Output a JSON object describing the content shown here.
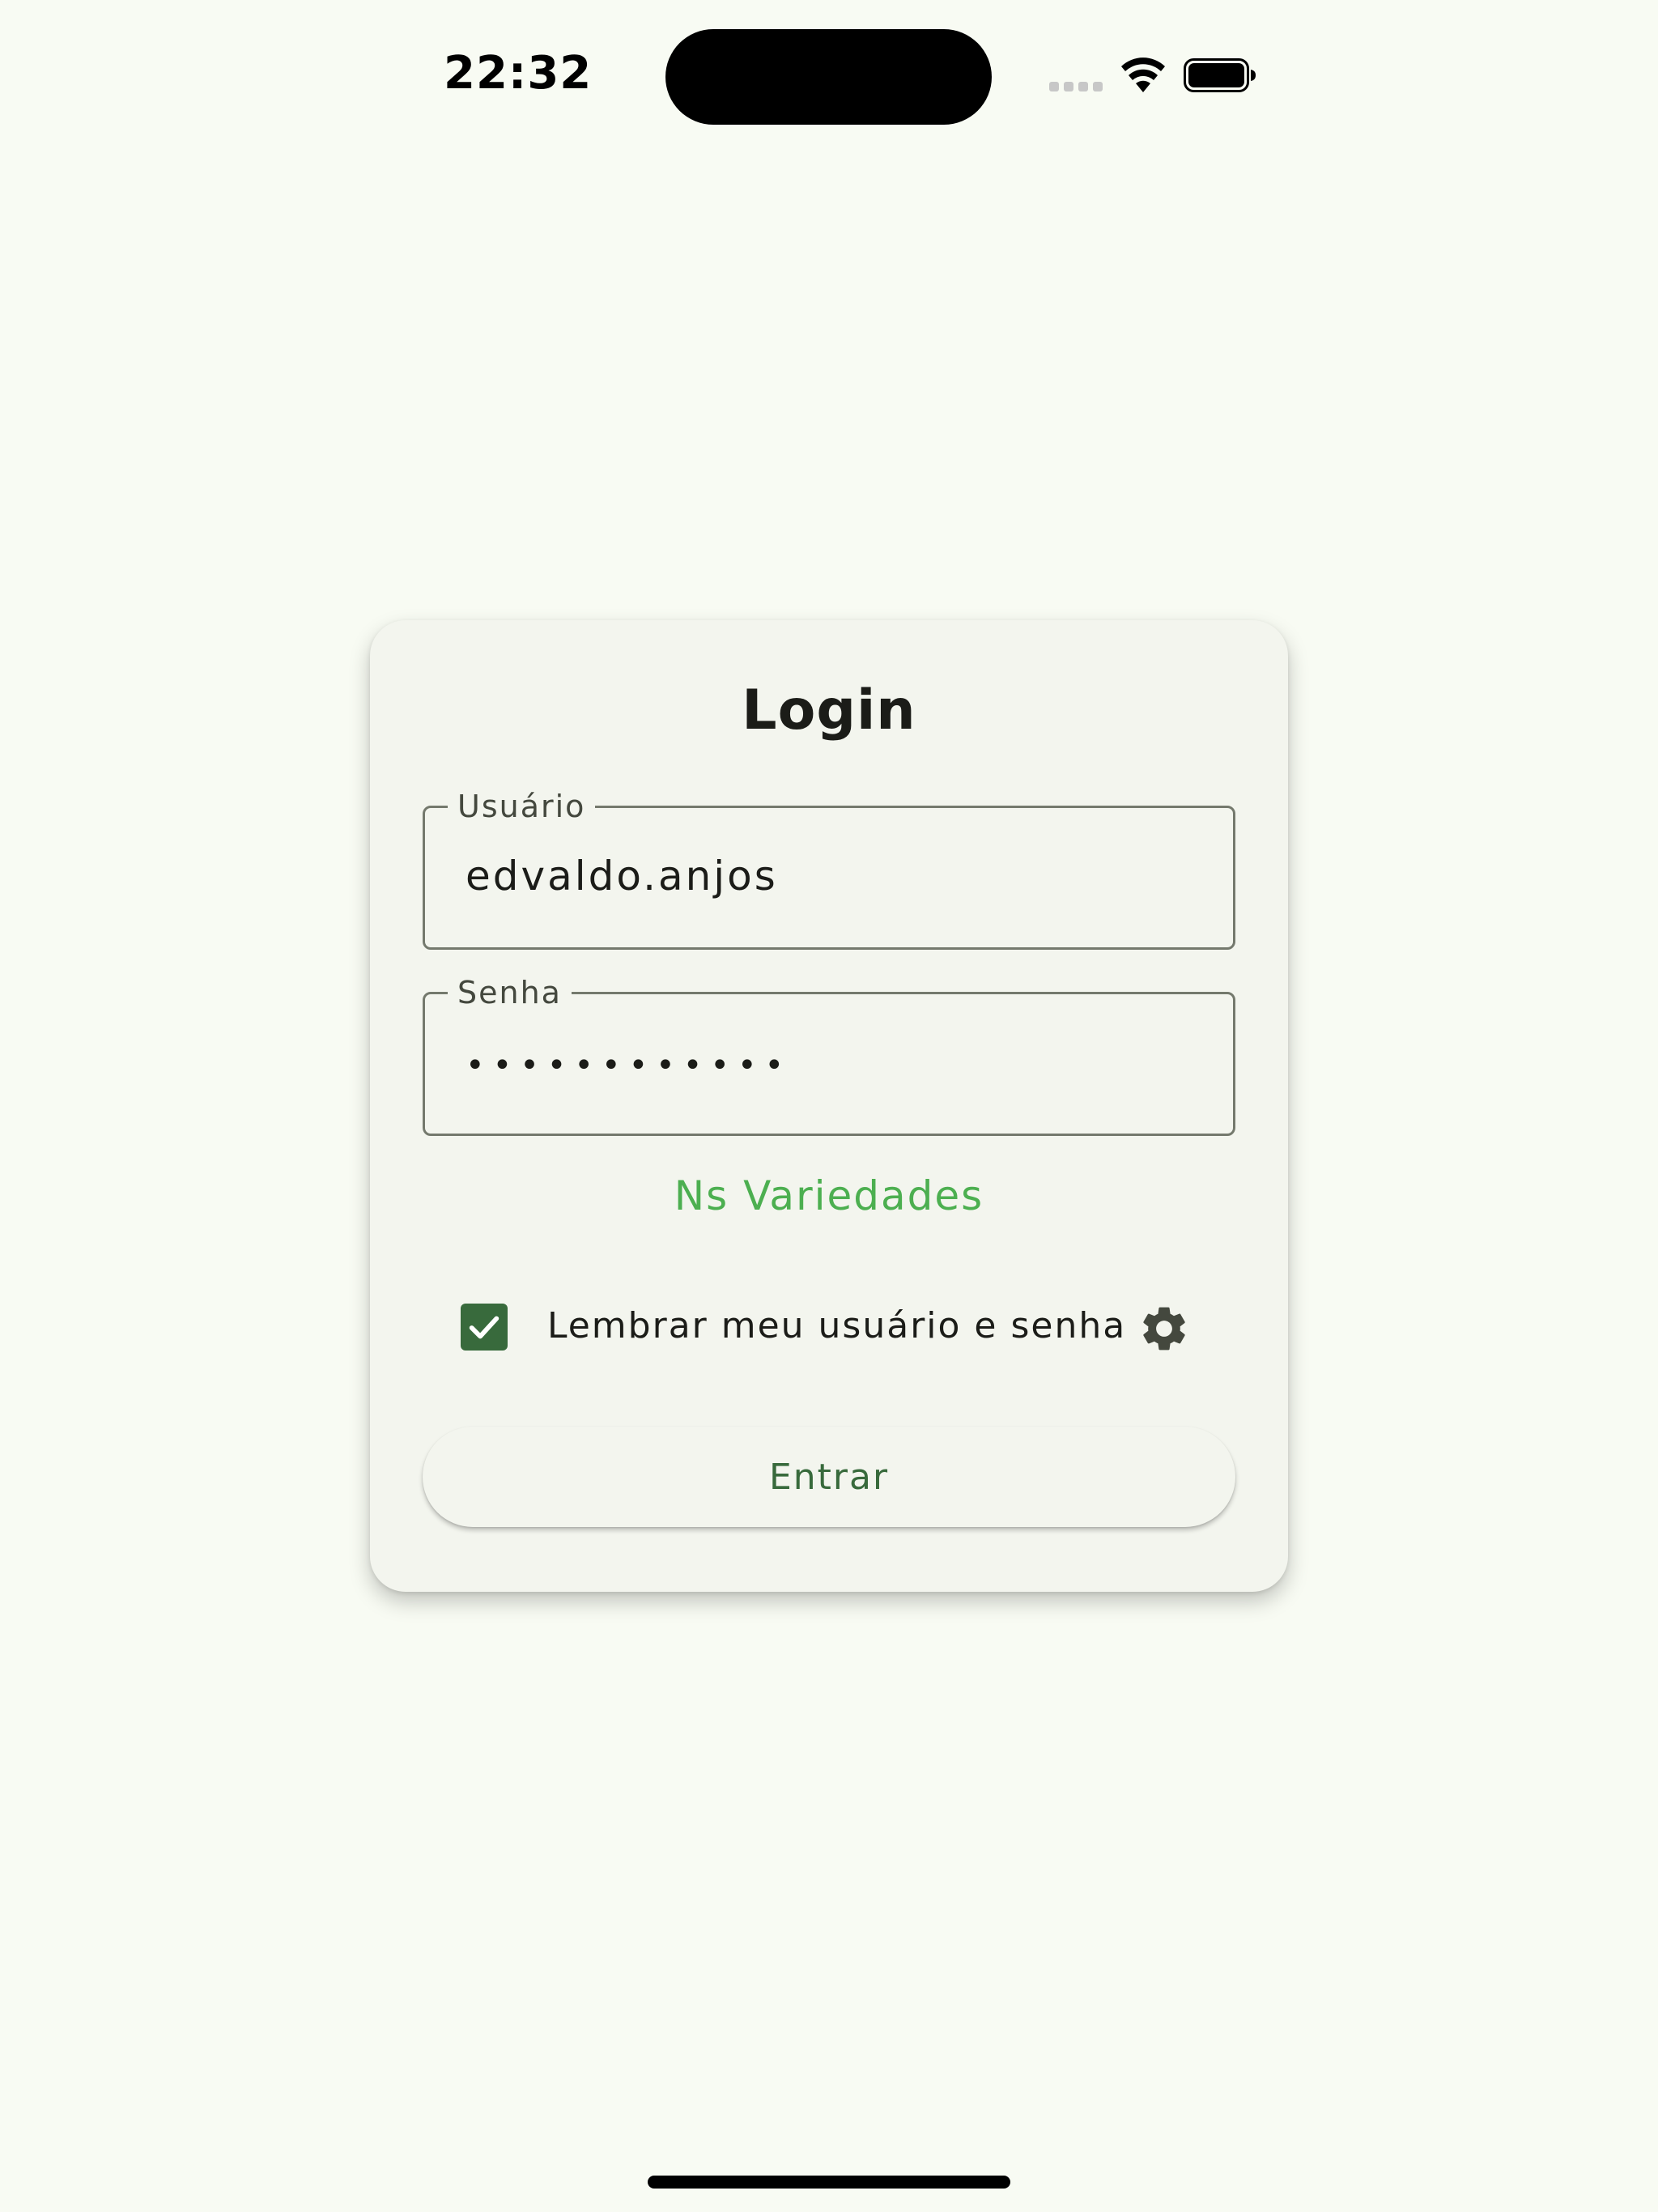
{
  "status_bar": {
    "time": "22:32"
  },
  "login": {
    "title": "Login",
    "username": {
      "label": "Usuário",
      "value": "edvaldo.anjos"
    },
    "password": {
      "label": "Senha",
      "value": "••••••••••••"
    },
    "brand": "Ns Variedades",
    "remember": {
      "label": "Lembrar meu usuário e senha",
      "checked": true
    },
    "submit_label": "Entrar"
  },
  "icons": {
    "settings": "gear-icon",
    "checkbox": "checkmark-icon"
  },
  "colors": {
    "background": "#f8fbf3",
    "card": "#f3f5ee",
    "primary": "#386a3c",
    "brand_text": "#4caf50",
    "outline": "#74796d"
  }
}
